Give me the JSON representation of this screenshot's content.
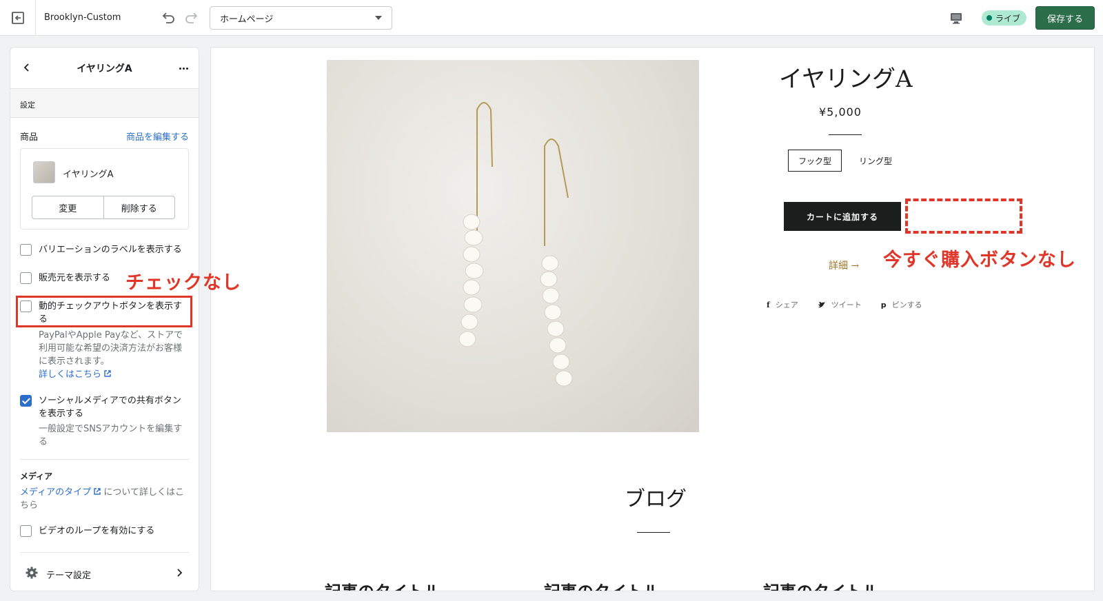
{
  "topbar": {
    "theme_name": "Brooklyn-Custom",
    "page_select": "ホームページ",
    "live_label": "ライブ",
    "save_label": "保存する"
  },
  "sidebar": {
    "title": "イヤリングA",
    "section_label": "設定",
    "product_label": "商品",
    "edit_product_link": "商品を編集する",
    "product_name": "イヤリングA",
    "change_label": "変更",
    "delete_label": "削除する",
    "options": [
      {
        "label": "バリエーションのラベルを表示する",
        "checked": false
      },
      {
        "label": "販売元を表示する",
        "checked": false
      },
      {
        "label": "動的チェックアウトボタンを表示する",
        "checked": false
      },
      {
        "label": "ソーシャルメディアでの共有ボタンを表示する",
        "checked": true
      },
      {
        "label": "ビデオのループを有効にする",
        "checked": false
      }
    ],
    "dynamic_help": "PayPalやApple Payなど、ストアで利用可能な希望の決済方法がお客様に表示されます。",
    "learn_more": "詳しくはこちら",
    "social_help": "一般設定でSNSアカウントを編集する",
    "media_title": "メディア",
    "media_link": "メディアのタイプ",
    "media_help": "について詳しくはこちら",
    "theme_settings": "テーマ設定"
  },
  "annotations": {
    "no_check": "チェックなし",
    "no_buy_now": "今すぐ購入ボタンなし",
    "color": "#e0362a"
  },
  "preview": {
    "product_title": "イヤリングA",
    "price": "¥5,000",
    "option_1": "フック型",
    "option_2": "リング型",
    "add_to_cart": "カートに追加する",
    "details": "詳細 →",
    "share": "シェア",
    "tweet": "ツイート",
    "pin": "ピンする",
    "blog_title": "ブログ",
    "article_title": "記事のタイトル"
  }
}
